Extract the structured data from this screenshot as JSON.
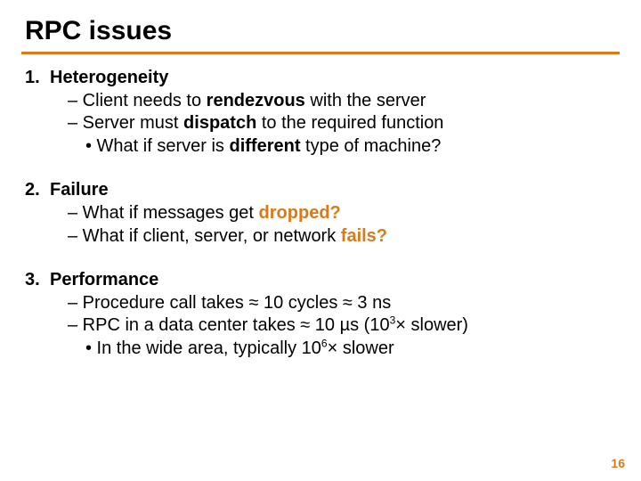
{
  "title": "RPC issues",
  "items": [
    {
      "num": "1.",
      "head": "Heterogeneity",
      "lines": [
        {
          "pre": "– Client needs to ",
          "bold": "rendezvous",
          "post": " with the server",
          "cls": "dash"
        },
        {
          "pre": "– Server must ",
          "bold": "dispatch",
          "post": " to the required function",
          "cls": "dash"
        },
        {
          "pre": "• What if server is ",
          "bold": "different",
          "post": " type of machine?",
          "cls": "bull"
        }
      ]
    },
    {
      "num": "2.",
      "head": "Failure",
      "lines": [
        {
          "pre": "– What if messages get ",
          "obold": "dropped?",
          "post": "",
          "cls": "dash"
        },
        {
          "pre": "– What if client, server, or network ",
          "obold": "fails?",
          "post": "",
          "cls": "dash"
        }
      ]
    },
    {
      "num": "3.",
      "head": "Performance",
      "lines": [
        {
          "pre": "– Procedure call takes ≈ 10 cycles ≈ 3 ns",
          "cls": "dash"
        },
        {
          "pre": "– RPC in a data center takes ≈ 10 µs (10",
          "sup": "3",
          "post": "× slower)",
          "cls": "dash"
        },
        {
          "pre": "• In the wide area, typically 10",
          "sup": "6",
          "post": "× slower",
          "cls": "bull"
        }
      ]
    }
  ],
  "page": "16"
}
